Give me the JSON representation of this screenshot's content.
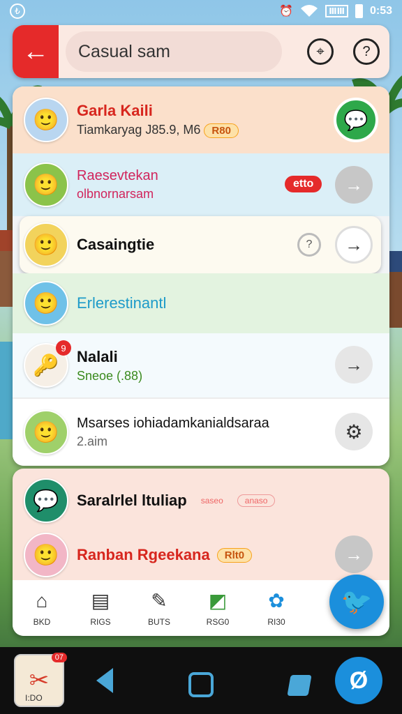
{
  "status_bar": {
    "time": "0:53",
    "left_badge": "₺",
    "alarm_icon": "alarm-icon",
    "wifi_icon": "wifi-icon",
    "sim_label": "ⅢⅢ",
    "battery_icon": "battery-icon"
  },
  "search": {
    "back_icon": "←",
    "query": "Casual sam",
    "filter_icon": "⌖",
    "help_icon": "?"
  },
  "list": [
    {
      "title": "Garla Kaili",
      "subtitle": "Tiamkaryag J85.9, M6",
      "chip": "R80",
      "avatar_emoji": "🙂",
      "row_bg": "#fbe0cb"
    },
    {
      "title": "Raesevtekan",
      "subtitle": "olbnornarsam",
      "chip": "etto",
      "avatar_emoji": "🙂",
      "action": "→",
      "row_bg": "#dbeff7"
    },
    {
      "title": "Casaingtie",
      "subtitle": "",
      "badge": "?",
      "avatar_emoji": "🙂",
      "action": "→",
      "row_bg": "#fdfaf0"
    },
    {
      "title": "Erlerestinantl",
      "subtitle": "",
      "avatar_emoji": "🙂",
      "row_bg": "#e3f3e0"
    },
    {
      "title": "Nalali",
      "subtitle": "Sneoe (.88)",
      "count": "9",
      "avatar_emoji": "🔑",
      "action": "→",
      "row_bg": "#f4fafd"
    },
    {
      "title": "Msarses iohiadamkanialdsaraa",
      "subtitle": "2.aim",
      "avatar_emoji": "🙂",
      "action": "⚙",
      "row_bg": "#ffffff"
    }
  ],
  "lower": [
    {
      "title": "Saralrlel ltuliap",
      "chip": "saseo",
      "chip2": "anaso",
      "avatar_emoji": "💬"
    },
    {
      "title": "Ranban Rgeekana",
      "chip": "Rlt0",
      "avatar_emoji": "🙂",
      "action": "→"
    }
  ],
  "bottom_nav": [
    {
      "icon": "⌂",
      "label": "BKD"
    },
    {
      "icon": "▤",
      "label": "RIGS"
    },
    {
      "icon": "✎",
      "label": "BUTS"
    },
    {
      "icon": "◩",
      "label": "RSG0"
    },
    {
      "icon": "✿",
      "label": "RI30"
    }
  ],
  "fab_icon": "🐦",
  "sys_nav": {
    "app_count": "07",
    "app_label": "I:DO",
    "assistant_icon": "Ø"
  },
  "colors": {
    "accent_red": "#e52a2a",
    "accent_blue": "#1b8fdc",
    "title_red": "#d7261e",
    "title_pink": "#d1245c",
    "title_cyan": "#1e9bc9",
    "chip_orange": "#f7a21b"
  }
}
